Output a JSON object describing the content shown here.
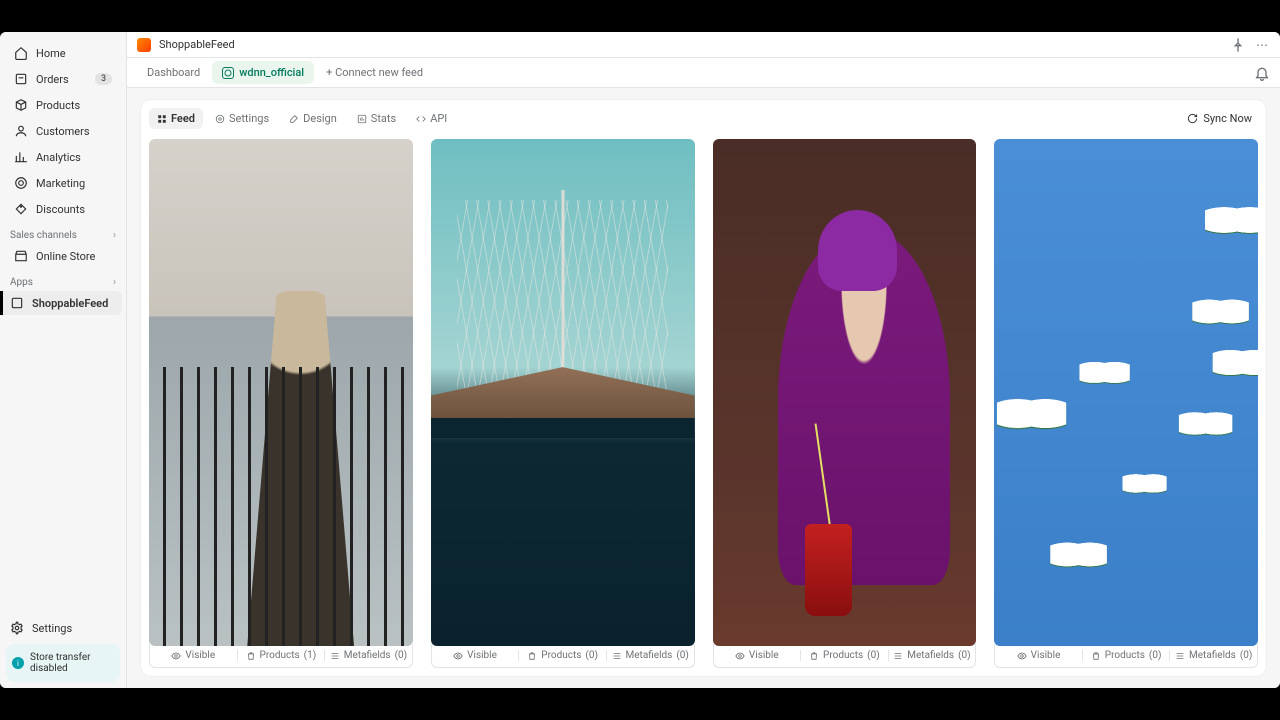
{
  "app": {
    "name": "ShoppableFeed"
  },
  "sidebar": {
    "nav": [
      {
        "label": "Home",
        "icon": "home"
      },
      {
        "label": "Orders",
        "icon": "orders",
        "badge": "3"
      },
      {
        "label": "Products",
        "icon": "products"
      },
      {
        "label": "Customers",
        "icon": "customers"
      },
      {
        "label": "Analytics",
        "icon": "analytics"
      },
      {
        "label": "Marketing",
        "icon": "marketing"
      },
      {
        "label": "Discounts",
        "icon": "discounts"
      }
    ],
    "channels_label": "Sales channels",
    "channels": [
      {
        "label": "Online Store"
      }
    ],
    "apps_label": "Apps",
    "apps": [
      {
        "label": "ShoppableFeed",
        "active": true
      }
    ],
    "settings_label": "Settings",
    "transfer_note": "Store transfer disabled"
  },
  "tabs": {
    "dashboard": "Dashboard",
    "feed_handle": "wdnn_official",
    "connect": "+ Connect new feed"
  },
  "sub_tabs": {
    "feed": "Feed",
    "settings": "Settings",
    "design": "Design",
    "stats": "Stats",
    "api": "API",
    "sync": "Sync Now"
  },
  "card_meta": {
    "visible": "Visible",
    "products": "Products",
    "metafields": "Metafields"
  },
  "cards": [
    {
      "visible": "Visible",
      "products_count": "(1)",
      "metafields_count": "(0)"
    },
    {
      "visible": "Visible",
      "products_count": "(0)",
      "metafields_count": "(0)"
    },
    {
      "visible": "Visible",
      "products_count": "(0)",
      "metafields_count": "(0)"
    },
    {
      "visible": "Visible",
      "products_count": "(0)",
      "metafields_count": "(0)"
    }
  ]
}
